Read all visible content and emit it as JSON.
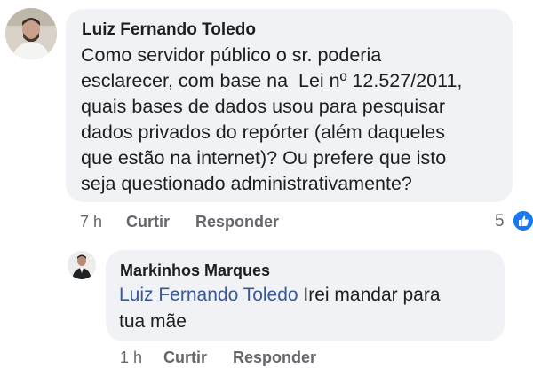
{
  "comment": {
    "author": "Luiz Fernando Toledo",
    "lines": [
      "Como servidor público o sr. poderia",
      "esclarecer, com base na  Lei nº 12.527/2011,",
      "quais bases de dados usou para pesquisar",
      "dados privados do repórter (além daqueles",
      "que estão na internet)? Ou prefere que isto",
      "seja questionado administrativamente?"
    ],
    "time": "7 h",
    "like_action": "Curtir",
    "reply_action": "Responder",
    "like_count": "5",
    "reaction_icon": "thumbs-up-icon",
    "reaction_color": "#1877f2"
  },
  "reply": {
    "author": "Markinhos Marques",
    "mention": "Luiz Fernando Toledo",
    "text_line1": " Irei mandar para",
    "text_line2": "tua mãe",
    "time": "1 h",
    "like_action": "Curtir",
    "reply_action": "Responder"
  }
}
